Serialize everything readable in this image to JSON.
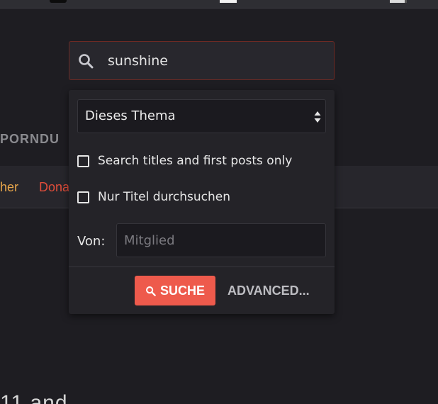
{
  "background": {
    "logo_text": "PORNDU",
    "nav": [
      "her",
      "Dona"
    ],
    "bottom_text": "11 and"
  },
  "search": {
    "value": "sunshine",
    "icon": "search-icon"
  },
  "panel": {
    "scope_select": {
      "selected": "Dieses Thema",
      "icon": "select-arrows-icon"
    },
    "options": [
      {
        "label": "Search titles and first posts only",
        "checked": false
      },
      {
        "label": "Nur Titel durchsuchen",
        "checked": false
      }
    ],
    "member": {
      "label": "Von:",
      "placeholder": "Mitglied"
    },
    "submit_label": "SUCHE",
    "advanced_label": "ADVANCED..."
  },
  "colors": {
    "accent": "#ee5a4c",
    "page_bg": "#1e1d22",
    "panel_bg": "#242328",
    "nav_orange": "#e7a54a",
    "nav_red": "#e04d3a"
  }
}
